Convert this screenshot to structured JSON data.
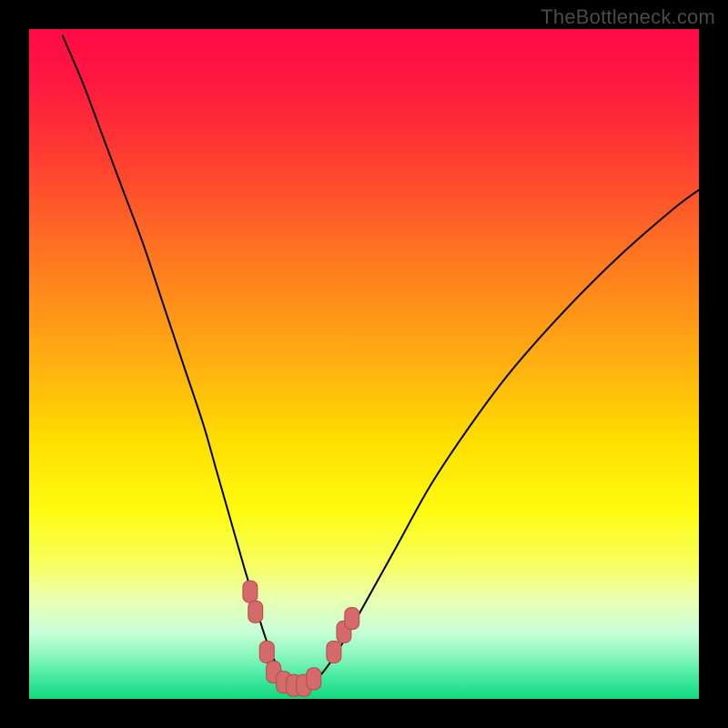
{
  "watermark": "TheBottleneck.com",
  "colors": {
    "background": "#000000",
    "gradient_stops": [
      {
        "offset": 0.0,
        "color": "#ff0a45"
      },
      {
        "offset": 0.08,
        "color": "#ff1840"
      },
      {
        "offset": 0.2,
        "color": "#ff4030"
      },
      {
        "offset": 0.35,
        "color": "#ff7a20"
      },
      {
        "offset": 0.5,
        "color": "#ffb010"
      },
      {
        "offset": 0.62,
        "color": "#ffe000"
      },
      {
        "offset": 0.72,
        "color": "#fffb10"
      },
      {
        "offset": 0.8,
        "color": "#f7ff60"
      },
      {
        "offset": 0.85,
        "color": "#eaffb0"
      },
      {
        "offset": 0.9,
        "color": "#c8ffd8"
      },
      {
        "offset": 0.94,
        "color": "#80f5b8"
      },
      {
        "offset": 0.97,
        "color": "#40e8a0"
      },
      {
        "offset": 1.0,
        "color": "#12d97f"
      }
    ],
    "curve": "#000000",
    "marker_fill": "#d46a6a",
    "marker_stroke": "#b44c4c"
  },
  "chart_data": {
    "type": "line",
    "title": "",
    "xlabel": "",
    "ylabel": "",
    "xlim": [
      0,
      100
    ],
    "ylim": [
      0,
      100
    ],
    "grid": false,
    "series": [
      {
        "name": "bottleneck-curve",
        "x": [
          5,
          8,
          11,
          14,
          17,
          20,
          23,
          26,
          28,
          30,
          32,
          33.5,
          35,
          36.5,
          38,
          39.5,
          41,
          43,
          46,
          50,
          55,
          60,
          66,
          72,
          80,
          88,
          96,
          100
        ],
        "y": [
          99,
          92,
          84,
          76,
          68,
          59,
          50,
          41,
          34,
          27,
          20,
          15,
          10,
          6,
          3.5,
          2,
          2,
          3,
          7,
          14,
          23,
          32,
          41,
          49,
          58,
          66,
          73,
          76
        ]
      }
    ],
    "markers": {
      "name": "highlight-points",
      "points": [
        {
          "x": 33.0,
          "y": 16
        },
        {
          "x": 33.8,
          "y": 13
        },
        {
          "x": 35.5,
          "y": 7
        },
        {
          "x": 36.5,
          "y": 4
        },
        {
          "x": 38.0,
          "y": 2.5
        },
        {
          "x": 39.5,
          "y": 2
        },
        {
          "x": 41.0,
          "y": 2
        },
        {
          "x": 42.5,
          "y": 3
        },
        {
          "x": 45.5,
          "y": 7
        },
        {
          "x": 47.0,
          "y": 10
        },
        {
          "x": 48.2,
          "y": 12
        }
      ]
    }
  }
}
